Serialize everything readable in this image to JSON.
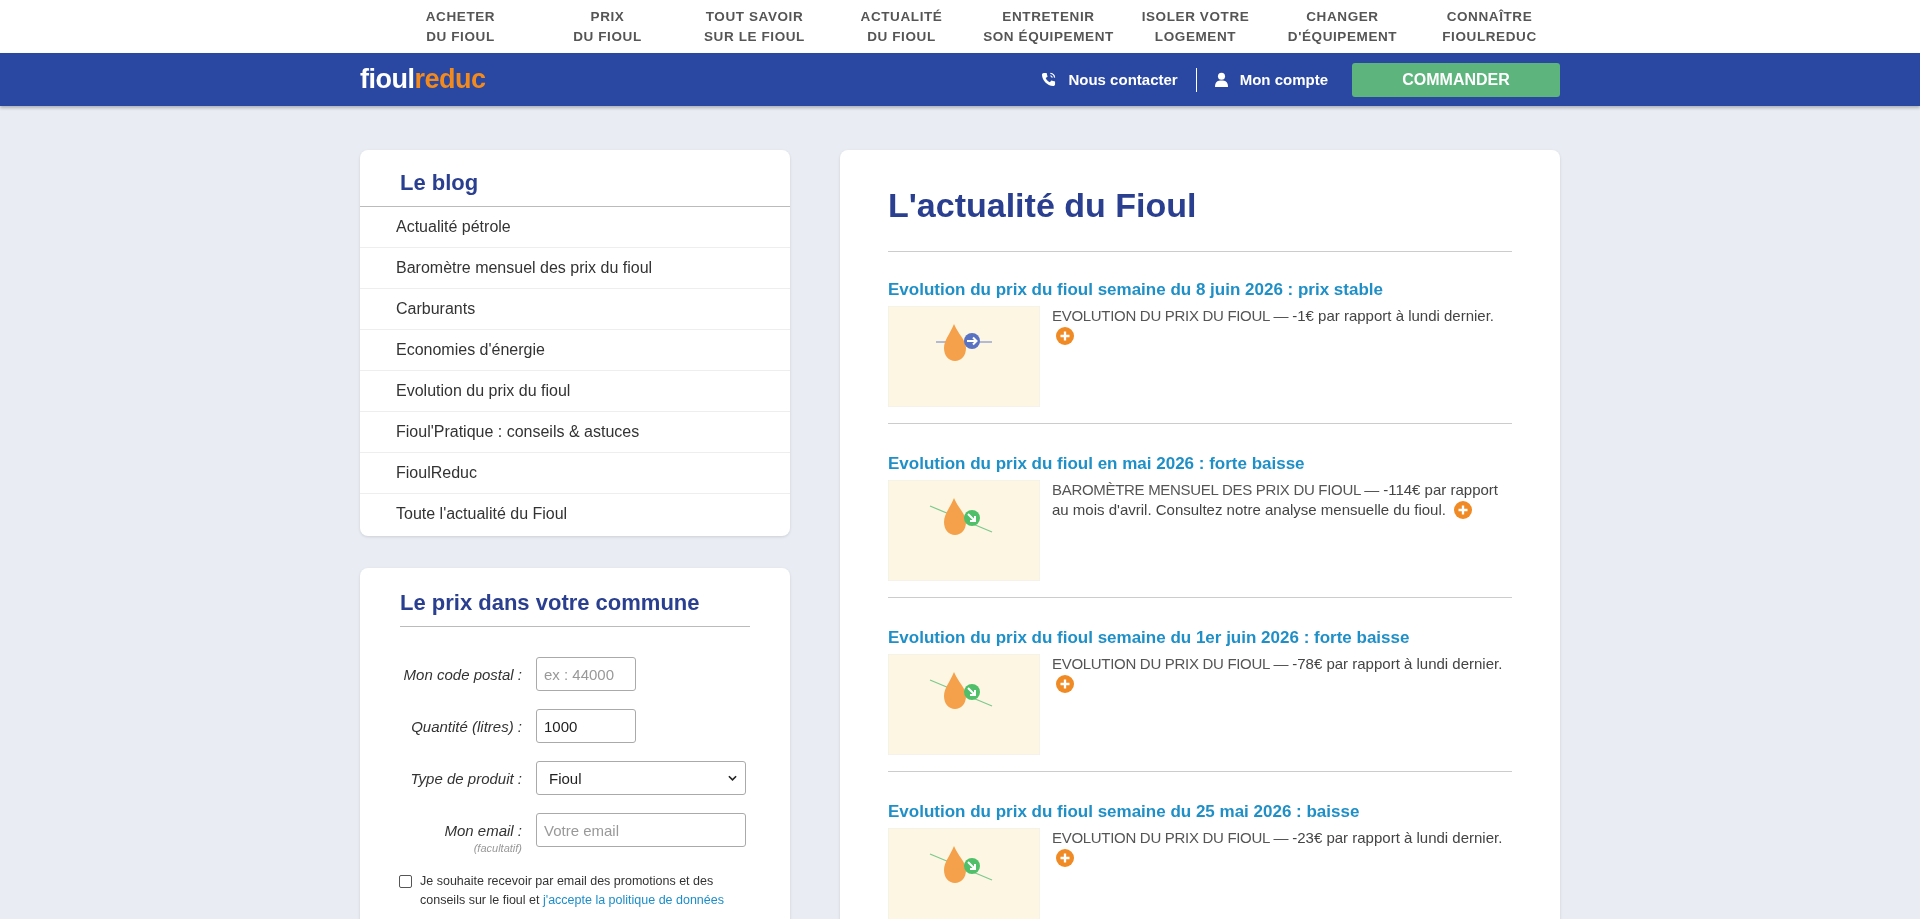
{
  "top_nav": [
    {
      "lines": [
        "ACHETER",
        "DU FIOUL"
      ]
    },
    {
      "lines": [
        "PRIX",
        "DU FIOUL"
      ]
    },
    {
      "lines": [
        "TOUT SAVOIR",
        "SUR LE FIOUL"
      ]
    },
    {
      "lines": [
        "ACTUALITÉ",
        "DU FIOUL"
      ]
    },
    {
      "lines": [
        "ENTRETENIR",
        "SON ÉQUIPEMENT"
      ]
    },
    {
      "lines": [
        "ISOLER VOTRE",
        "LOGEMENT"
      ]
    },
    {
      "lines": [
        "CHANGER",
        "D'ÉQUIPEMENT"
      ]
    },
    {
      "lines": [
        "CONNAÎTRE",
        "FIOULREDUC"
      ]
    }
  ],
  "header": {
    "logo_main": "fioul",
    "logo_accent": "reduc",
    "contact": "Nous contacter",
    "account": "Mon compte",
    "order_button": "COMMANDER"
  },
  "blog": {
    "title": "Le blog",
    "items": [
      "Actualité pétrole",
      "Baromètre mensuel des prix du fioul",
      "Carburants",
      "Economies d'énergie",
      "Evolution du prix du fioul",
      "Fioul'Pratique : conseils & astuces",
      "FioulReduc",
      "Toute l'actualité du Fioul"
    ]
  },
  "price_form": {
    "title": "Le prix dans votre commune",
    "fields": [
      {
        "kind": "input",
        "label": "Mon code postal :",
        "placeholder": "ex : 44000"
      },
      {
        "kind": "input",
        "label": "Quantité (litres) :",
        "value": "1000"
      },
      {
        "kind": "select",
        "label": "Type de produit :",
        "value": "Fioul"
      },
      {
        "kind": "wide-input",
        "label": "Mon email :",
        "note": "(facultatif)",
        "placeholder": "Votre email"
      }
    ],
    "consent": {
      "checked": false,
      "text": "Je souhaite recevoir par email des promotions et des conseils sur le fioul et",
      "link": "j'accepte la politique de données"
    }
  },
  "news": {
    "title": "L'actualité du Fioul",
    "articles": [
      {
        "title": "Evolution du prix du fioul semaine du 8 juin 2026 : prix stable",
        "trending_down": false,
        "category": "EVOLUTION DU PRIX DU FIOUL —",
        "summary": "-1€ par rapport à lundi dernier."
      },
      {
        "title": "Evolution du prix du fioul en mai 2026 : forte baisse",
        "trending_down": true,
        "category": "BAROMÈTRE MENSUEL DES PRIX DU FIOUL —",
        "summary": "-114€ par rapport au mois d'avril. Consultez notre analyse mensuelle du fioul."
      },
      {
        "title": "Evolution du prix du fioul semaine du 1er juin 2026 : forte baisse",
        "trending_down": true,
        "category": "EVOLUTION DU PRIX DU FIOUL —",
        "summary": "-78€ par rapport à lundi dernier."
      },
      {
        "title": "Evolution du prix du fioul semaine du 25 mai 2026 : baisse",
        "trending_down": true,
        "category": "EVOLUTION DU PRIX DU FIOUL —",
        "summary": "-23€ par rapport à lundi dernier."
      }
    ]
  }
}
